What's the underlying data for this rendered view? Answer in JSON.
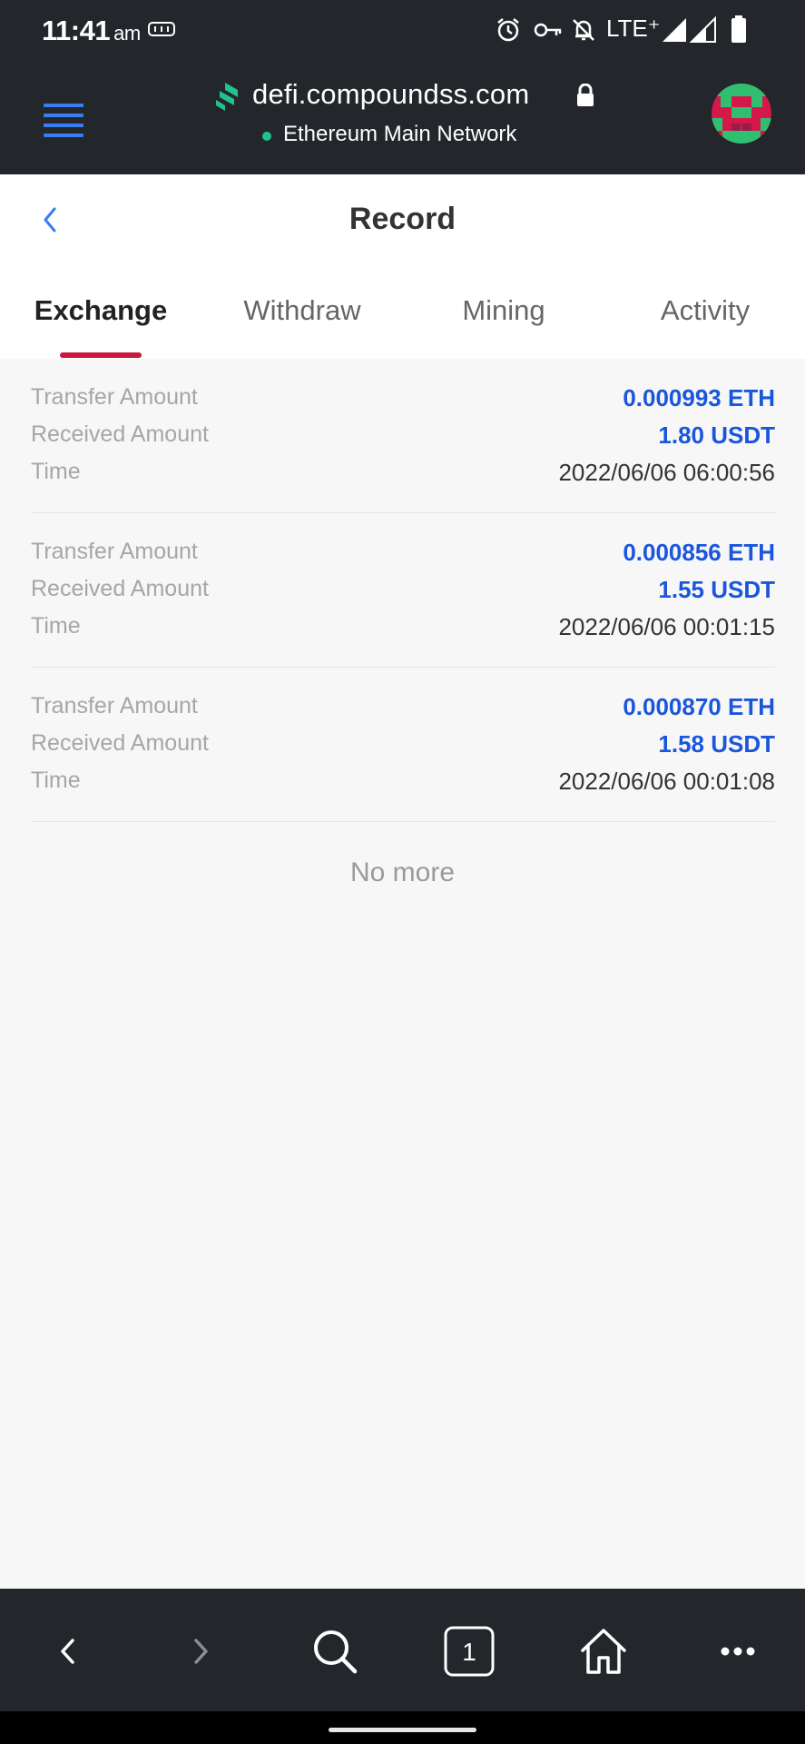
{
  "status_bar": {
    "time": "11:41",
    "ampm": "am",
    "network_type": "LTE⁺"
  },
  "browser": {
    "domain": "defi.compoundss.com",
    "network_label": "Ethereum Main Network"
  },
  "page": {
    "title": "Record",
    "tabs": [
      {
        "label": "Exchange",
        "active": true
      },
      {
        "label": "Withdraw",
        "active": false
      },
      {
        "label": "Mining",
        "active": false
      },
      {
        "label": "Activity",
        "active": false
      }
    ]
  },
  "records": [
    {
      "transfer_label": "Transfer Amount",
      "transfer_value": "0.000993 ETH",
      "received_label": "Received Amount",
      "received_value": "1.80 USDT",
      "time_label": "Time",
      "time_value": "2022/06/06 06:00:56"
    },
    {
      "transfer_label": "Transfer Amount",
      "transfer_value": "0.000856 ETH",
      "received_label": "Received Amount",
      "received_value": "1.55 USDT",
      "time_label": "Time",
      "time_value": "2022/06/06 00:01:15"
    },
    {
      "transfer_label": "Transfer Amount",
      "transfer_value": "0.000870 ETH",
      "received_label": "Received Amount",
      "received_value": "1.58 USDT",
      "time_label": "Time",
      "time_value": "2022/06/06 00:01:08"
    }
  ],
  "footer_text": "No more",
  "bottom_bar": {
    "tab_count": "1"
  },
  "colors": {
    "accent_blue": "#1a56db",
    "tab_indicator": "#c8183f",
    "network_dot": "#21c38d",
    "bar_bg": "#23262b"
  },
  "icons": [
    "alarm-icon",
    "key-icon",
    "notifications-off-icon",
    "signal-icon",
    "battery-icon",
    "menu-icon",
    "lock-icon",
    "back-icon",
    "search-icon",
    "home-icon",
    "more-icon"
  ]
}
